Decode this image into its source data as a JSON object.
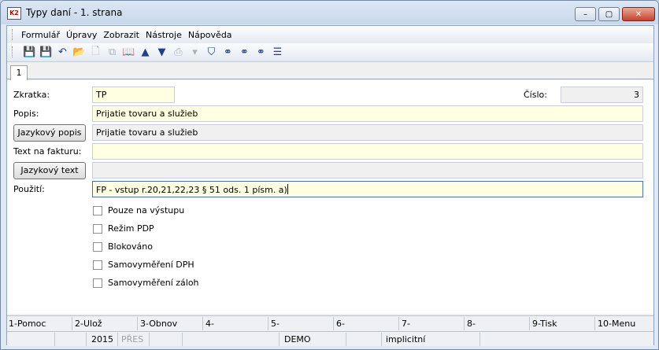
{
  "window": {
    "title": "Typy daní - 1. strana",
    "logo_text": "K2",
    "min_glyph": "–",
    "max_glyph": "▢",
    "close_glyph": "✕"
  },
  "menu": [
    "Formulář",
    "Úpravy",
    "Zobrazit",
    "Nástroje",
    "Nápověda"
  ],
  "toolbar": {
    "icons": [
      {
        "name": "save-icon",
        "glyph": "💾",
        "disabled": false
      },
      {
        "name": "save-as-icon",
        "glyph": "💾",
        "disabled": false
      },
      {
        "name": "undo-icon",
        "glyph": "↶",
        "disabled": false
      },
      {
        "name": "open-folder-icon",
        "glyph": "📂",
        "disabled": true
      },
      {
        "name": "new-document-icon",
        "glyph": "🗋",
        "disabled": true
      },
      {
        "name": "copy-icon",
        "glyph": "⧉",
        "disabled": true
      },
      {
        "name": "book-icon",
        "glyph": "📖",
        "disabled": true
      },
      {
        "name": "arrow-up-icon",
        "glyph": "▲",
        "disabled": false
      },
      {
        "name": "arrow-down-icon",
        "glyph": "▼",
        "disabled": false
      },
      {
        "name": "print-icon",
        "glyph": "⎙",
        "disabled": true
      },
      {
        "name": "dropdown-arrow-icon",
        "glyph": "▾",
        "disabled": true
      },
      {
        "name": "filter-icon",
        "glyph": "⛉",
        "disabled": false
      },
      {
        "name": "binoculars-icon",
        "glyph": "⚭",
        "disabled": false
      },
      {
        "name": "find-next-icon",
        "glyph": "⚭",
        "disabled": false
      },
      {
        "name": "find-replace-icon",
        "glyph": "⚭",
        "disabled": false
      },
      {
        "name": "menu-lines-icon",
        "glyph": "☰",
        "disabled": false
      }
    ]
  },
  "tab": {
    "label": "1"
  },
  "form": {
    "zkratka_label": "Zkratka:",
    "zkratka_value": "TP",
    "cislo_label": "Číslo:",
    "cislo_value": "3",
    "popis_label": "Popis:",
    "popis_value": "Prijatie tovaru a služieb",
    "jazykovy_popis_button": "Jazykový popis",
    "jazykovy_popis_value": "Prijatie tovaru a služieb",
    "text_na_fakturu_label": "Text na fakturu:",
    "text_na_fakturu_value": "",
    "jazykovy_text_button": "Jazykový text",
    "jazykovy_text_value": "",
    "pouziti_label": "Použití:",
    "pouziti_value": "FP - vstup  r.20,21,22,23   § 51 ods. 1 písm. a)",
    "checkboxes": [
      {
        "label": "Pouze na výstupu",
        "checked": false
      },
      {
        "label": "Režim PDP",
        "checked": false
      },
      {
        "label": "Blokováno",
        "checked": false
      },
      {
        "label": "Samovyměření DPH",
        "checked": false
      },
      {
        "label": "Samovyměření záloh",
        "checked": false
      }
    ]
  },
  "fkeys": [
    "1-Pomoc",
    "2-Ulož",
    "3-Obnov",
    "4-",
    "5-",
    "6-",
    "7-",
    "8-",
    "9-Tisk",
    "10-Menu"
  ],
  "status": {
    "year": "2015",
    "mode": "PŘES",
    "database": "DEMO",
    "profile": "implicitní"
  }
}
